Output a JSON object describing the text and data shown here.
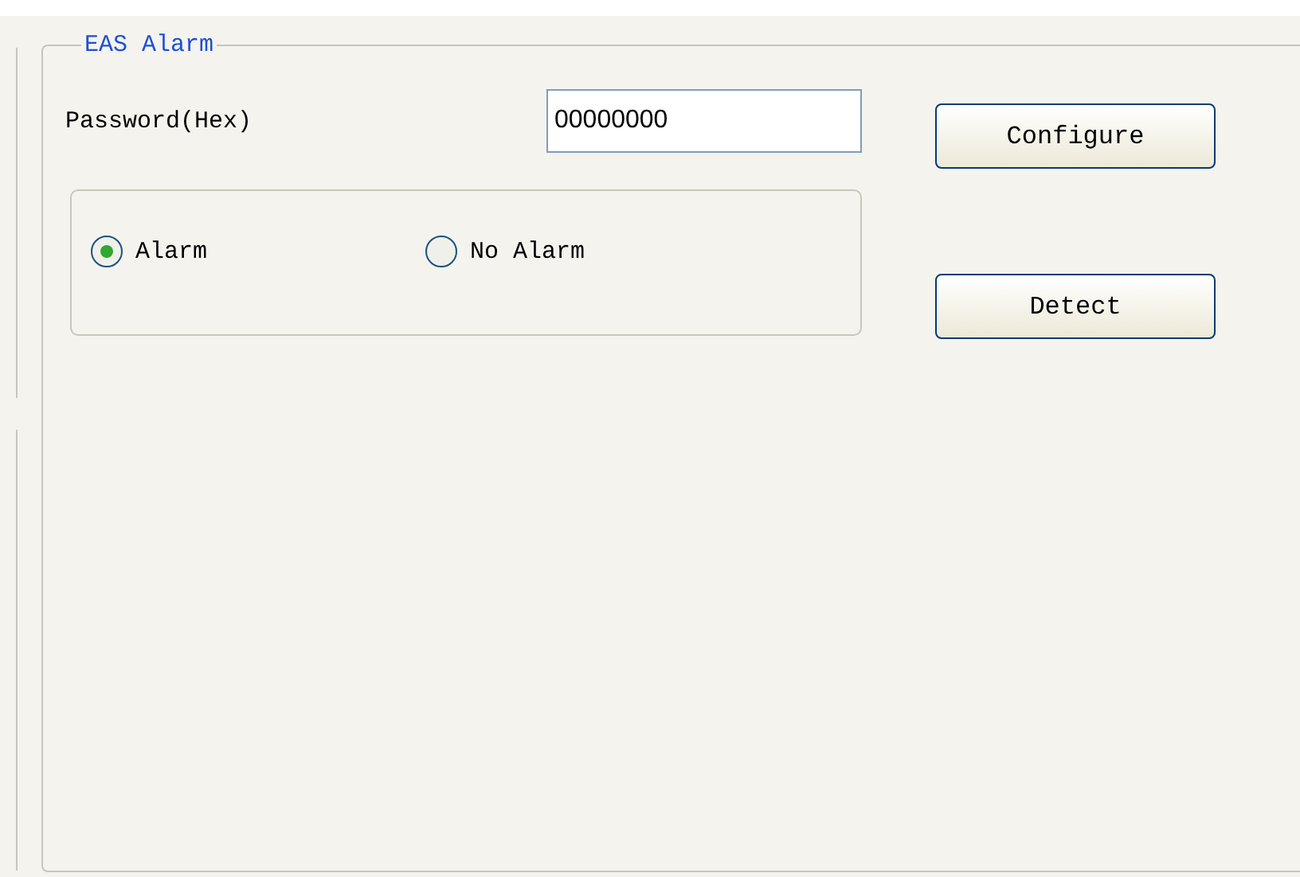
{
  "group": {
    "title": "EAS Alarm"
  },
  "password": {
    "label": "Password(Hex)",
    "value": "00000000"
  },
  "options": [
    {
      "label": "Alarm",
      "selected": true
    },
    {
      "label": "No Alarm",
      "selected": false
    }
  ],
  "buttons": [
    "Configure",
    "Detect"
  ]
}
